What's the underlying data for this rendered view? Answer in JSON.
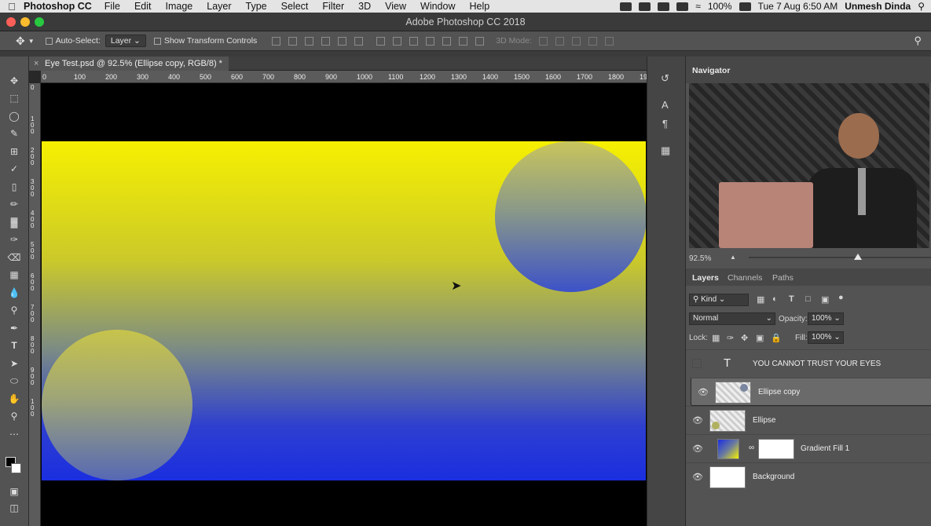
{
  "menubar": {
    "app_name": "Photoshop CC",
    "items": [
      "File",
      "Edit",
      "Image",
      "Layer",
      "Type",
      "Select",
      "Filter",
      "3D",
      "View",
      "Window",
      "Help"
    ],
    "battery": "100%",
    "clock": "Tue 7 Aug  6:50 AM",
    "user": "Unmesh Dinda"
  },
  "window": {
    "title": "Adobe Photoshop CC 2018"
  },
  "options": {
    "auto_select_label": "Auto-Select:",
    "auto_select_value": "Layer",
    "show_transform_label": "Show Transform Controls",
    "mode_3d_label": "3D Mode:"
  },
  "document": {
    "tab_label": "Eye Test.psd @ 92.5% (Ellipse copy, RGB/8) *",
    "ruler_labels": [
      "0",
      "100",
      "200",
      "300",
      "400",
      "500",
      "600",
      "700",
      "800",
      "900",
      "1000",
      "1100",
      "1200",
      "1300",
      "1400",
      "1500",
      "1600",
      "1700",
      "1800",
      "19"
    ],
    "vruler_labels": [
      "0",
      "1 0 0",
      "2 0 0",
      "3 0 0",
      "4 0 0",
      "5 0 0",
      "6 0 0",
      "7 0 0",
      "8 0 0",
      "9 0 0",
      "1 0 0"
    ]
  },
  "navigator": {
    "title": "Navigator",
    "zoom": "92.5%",
    "slider_level": 0.6
  },
  "layers_panel": {
    "tabs": [
      "Layers",
      "Channels",
      "Paths"
    ],
    "filter_label": "Kind",
    "blend_mode": "Normal",
    "opacity_label": "Opacity:",
    "opacity_value": "100%",
    "lock_label": "Lock:",
    "fill_label": "Fill:",
    "fill_value": "100%",
    "layers": [
      {
        "name": "YOU CANNOT TRUST YOUR EYES",
        "kind": "text",
        "visible": false,
        "selected": false
      },
      {
        "name": "Ellipse copy",
        "kind": "shape",
        "visible": true,
        "selected": true
      },
      {
        "name": "Ellipse",
        "kind": "shape",
        "visible": true,
        "selected": false
      },
      {
        "name": "Gradient Fill 1",
        "kind": "fill",
        "visible": true,
        "selected": false
      },
      {
        "name": "Background",
        "kind": "pixel",
        "visible": true,
        "selected": false
      }
    ]
  },
  "colors": {
    "gradient_top": "#f6f000",
    "gradient_bottom": "#1a2ee0",
    "panel": "#535353",
    "selected_layer": "#6a6a6a"
  }
}
